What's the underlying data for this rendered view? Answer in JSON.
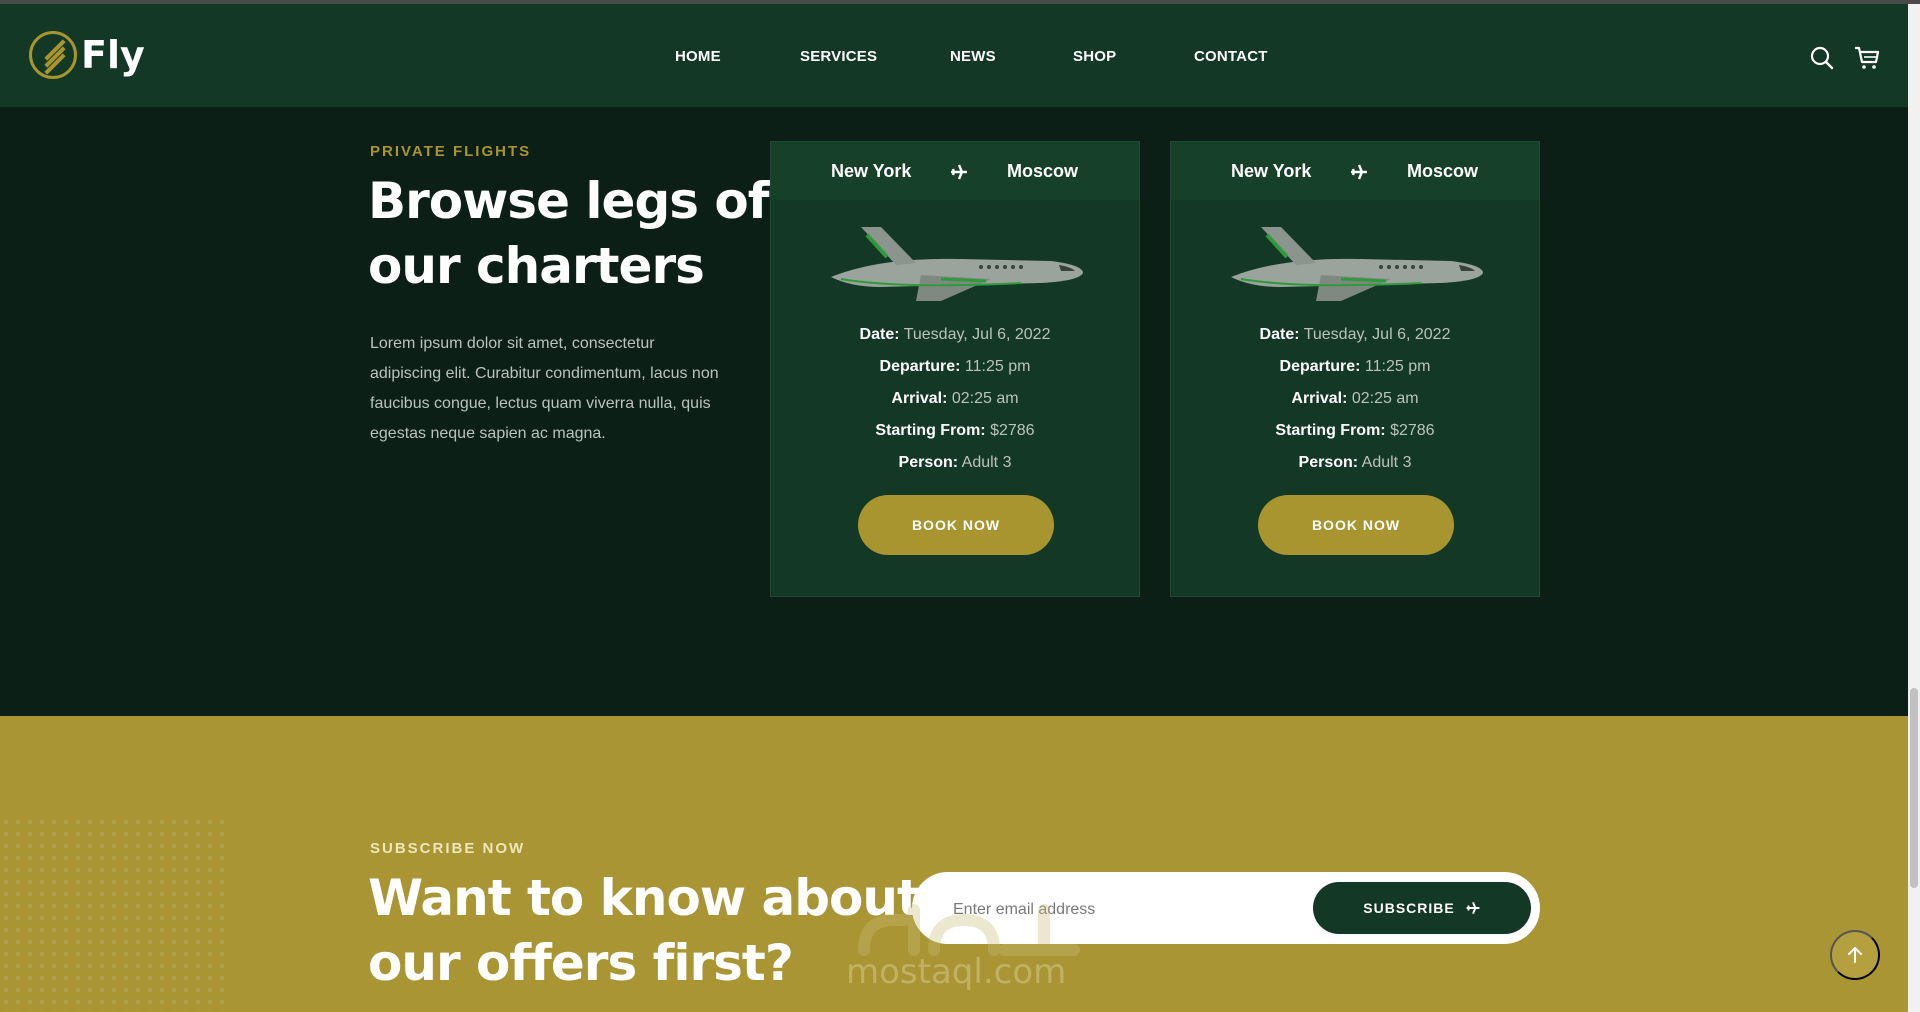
{
  "brand": {
    "name": "Fly"
  },
  "nav": {
    "items": [
      {
        "label": "HOME"
      },
      {
        "label": "SERVICES"
      },
      {
        "label": "NEWS"
      },
      {
        "label": "SHOP"
      },
      {
        "label": "CONTACT"
      }
    ]
  },
  "flights": {
    "eyebrow": "PRIVATE FLIGHTS",
    "heading_line1": "Browse legs of",
    "heading_line2": "our charters",
    "paragraph_lines": [
      "Lorem ipsum dolor sit amet, consectetur",
      "adipiscing elit. Curabitur condimentum, lacus non",
      "faucibus congue, lectus quam viverra nulla, quis",
      "egestas neque sapien ac magna."
    ],
    "cards": [
      {
        "from": "New York",
        "to": "Moscow",
        "date_label": "Date:",
        "date": "Tuesday, Jul 6, 2022",
        "departure_label": "Departure:",
        "departure": "11:25 pm",
        "arrival_label": "Arrival:",
        "arrival": "02:25 am",
        "price_label": "Starting From:",
        "price": "$2786",
        "person_label": "Person:",
        "person": "Adult 3",
        "button": "BOOK NOW"
      },
      {
        "from": "New York",
        "to": "Moscow",
        "date_label": "Date:",
        "date": "Tuesday, Jul 6, 2022",
        "departure_label": "Departure:",
        "departure": "11:25 pm",
        "arrival_label": "Arrival:",
        "arrival": "02:25 am",
        "price_label": "Starting From:",
        "price": "$2786",
        "person_label": "Person:",
        "person": "Adult 3",
        "button": "BOOK NOW"
      }
    ]
  },
  "subscribe": {
    "eyebrow": "SUBSCRIBE NOW",
    "heading_line1": "Want to know about",
    "heading_line2": "our offers first?",
    "placeholder": "Enter email address",
    "button": "SUBSCRIBE"
  },
  "watermark": {
    "text": "mostaql.com"
  },
  "colors": {
    "header_bg": "#143826",
    "section_bg": "#0c1f16",
    "accent_gold": "#a8952f",
    "subscribe_bg": "#a99534"
  },
  "icons": [
    "logo-icon",
    "search-icon",
    "cart-icon",
    "plane-icon",
    "jet-image",
    "arrow-up-icon"
  ]
}
